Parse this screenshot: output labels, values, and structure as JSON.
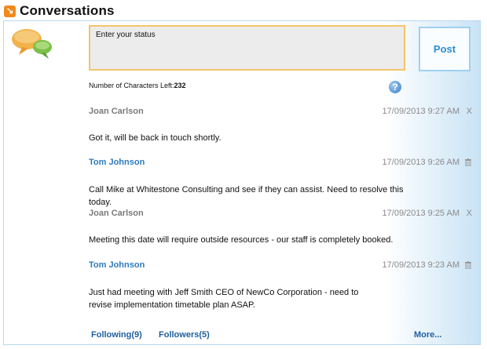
{
  "header": {
    "title": "Conversations",
    "icon": "arrow-icon"
  },
  "status": {
    "placeholder": "Enter your status",
    "post_label": "Post",
    "chars_left_label": "Number of Characters Left:",
    "chars_left_value": "232"
  },
  "messages": [
    {
      "author": "Joan Carlson",
      "timestamp": "17/09/2013 9:27 AM",
      "action": "X",
      "body": "Got it, will be back in touch shortly."
    },
    {
      "author": "Tom Johnson",
      "timestamp": "17/09/2013 9:26 AM",
      "action": "trash-icon",
      "body": "Call Mike at Whitestone Consulting and see if they can assist. Need to resolve this today."
    },
    {
      "author": "Joan Carlson",
      "timestamp": "17/09/2013 9:25 AM",
      "action": "X",
      "body": "Meeting this date will require outside resources - our staff is completely booked."
    },
    {
      "author": "Tom Johnson",
      "timestamp": "17/09/2013 9:23 AM",
      "action": "trash-icon",
      "body": "Just had meeting with Jeff Smith CEO of NewCo Corporation - need to revise implementation timetable plan ASAP."
    }
  ],
  "footer": {
    "following": "Following(9)",
    "followers": "Followers(5)",
    "more": "More..."
  },
  "colors": {
    "accent": "#f08a1c",
    "link": "#2c7bbf",
    "border": "#b9d7ea"
  }
}
